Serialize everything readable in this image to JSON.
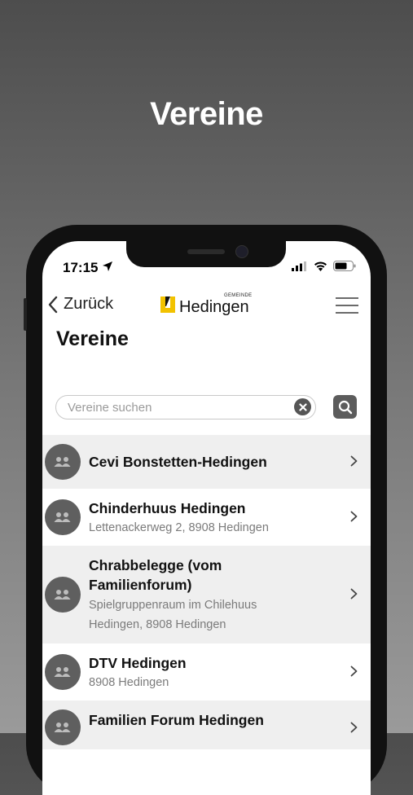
{
  "promo": {
    "title": "Vereine"
  },
  "status_bar": {
    "time": "17:15"
  },
  "nav": {
    "back_label": "Zurück",
    "logo_small": "GEMEINDE",
    "logo_name": "Hedingen"
  },
  "page": {
    "title": "Vereine"
  },
  "search": {
    "placeholder": "Vereine suchen",
    "value": ""
  },
  "items": [
    {
      "title": "Cevi Bonstetten-Hedingen",
      "sub1": "",
      "sub2": ""
    },
    {
      "title": "Chinderhuus Hedingen",
      "sub1": "Lettenackerweg 2, 8908 Hedingen",
      "sub2": ""
    },
    {
      "title": "Chrabbelegge (vom",
      "title2": "Familienforum)",
      "sub1": "Spielgruppenraum im Chilehuus",
      "sub2": "Hedingen, 8908 Hedingen"
    },
    {
      "title": "DTV Hedingen",
      "sub1": "8908 Hedingen",
      "sub2": ""
    },
    {
      "title": "Familien Forum Hedingen",
      "sub1": "",
      "sub2": ""
    }
  ],
  "colors": {
    "accent_logo": "#f2c200",
    "row_shade": "#efefef",
    "avatar": "#5f5f5f"
  }
}
